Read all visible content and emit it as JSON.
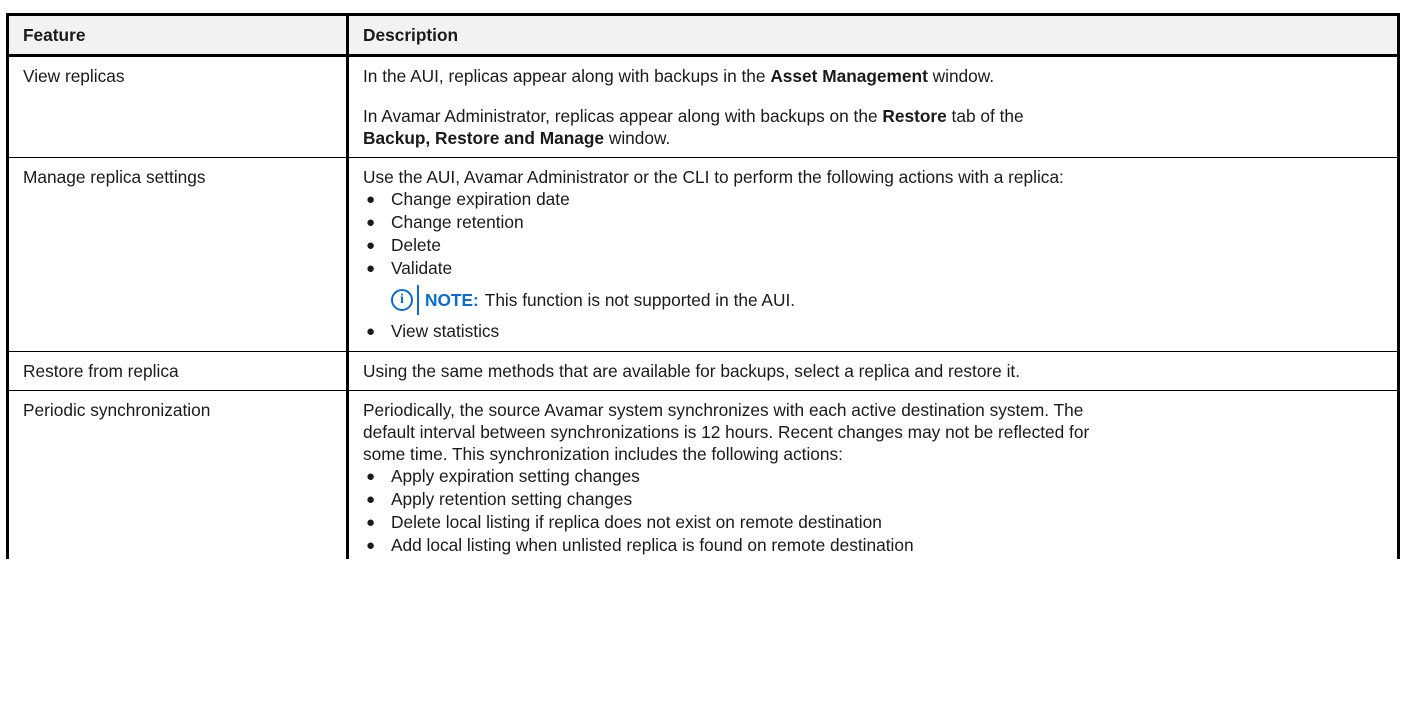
{
  "table": {
    "headers": {
      "feature": "Feature",
      "description": "Description"
    },
    "rows": [
      {
        "feature": "View replicas",
        "p1": {
          "a": "In the AUI, replicas appear along with backups in the ",
          "b": "Asset Management",
          "c": " window."
        },
        "p2": {
          "a": "In Avamar Administrator, replicas appear along with backups on the ",
          "b": "Restore",
          "c": " tab of the ",
          "d": "Backup, Restore and Manage",
          "e": " window."
        }
      },
      {
        "feature": "Manage replica settings",
        "intro": "Use the AUI, Avamar Administrator or the CLI to perform the following actions with a replica:",
        "bullets": [
          "Change expiration date",
          "Change retention",
          "Delete",
          "Validate",
          "View statistics"
        ],
        "note": {
          "icon": "info-icon",
          "label": "NOTE:",
          "text": " This function is not supported in the AUI."
        }
      },
      {
        "feature": "Restore from replica",
        "text": "Using the same methods that are available for backups, select a replica and restore it."
      },
      {
        "feature": "Periodic synchronization",
        "line1": "Periodically, the source Avamar system synchronizes with each active destination system. The",
        "line2": "default interval between synchronizations is 12 hours. Recent changes may not be reflected for",
        "line3": "some time. This synchronization includes the following actions:",
        "bullets": [
          "Apply expiration setting changes",
          "Apply retention setting changes",
          "Delete local listing if replica does not exist on remote destination",
          "Add local listing when unlisted replica is found on remote destination"
        ]
      }
    ]
  },
  "colors": {
    "note_accent": "#0a6ed1",
    "header_bg": "#f2f2f2"
  }
}
